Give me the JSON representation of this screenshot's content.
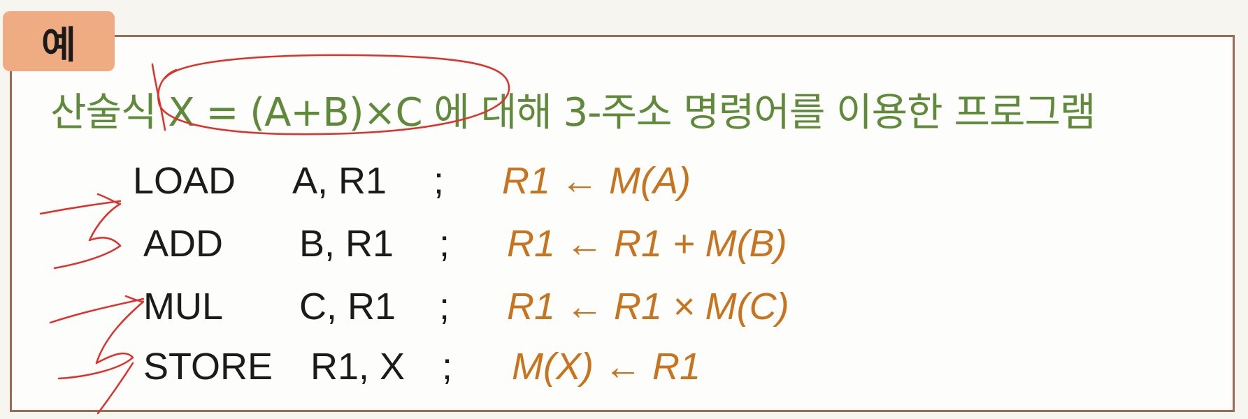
{
  "example_tag": "예",
  "title": "산술식 X = (A+B)×C 에 대해 3-주소 명령어를 이용한 프로그램",
  "program": [
    {
      "op": "LOAD",
      "operands": "A, R1",
      "sep": ";",
      "comment": "R1 ← M(A)"
    },
    {
      "op": "ADD",
      "operands": "B, R1",
      "sep": ";",
      "comment": "R1 ← R1 + M(B)"
    },
    {
      "op": "MUL",
      "operands": "C, R1",
      "sep": ";",
      "comment": "R1 ← R1 × M(C)"
    },
    {
      "op": "STORE",
      "operands": "R1, X",
      "sep": ";",
      "comment": "M(X) ← R1"
    }
  ],
  "colors": {
    "title": "#5f8a3a",
    "comment": "#c8741e",
    "tag_bg": "#efab82",
    "frame_border": "#a06a52",
    "annotation": "#e0302a"
  }
}
